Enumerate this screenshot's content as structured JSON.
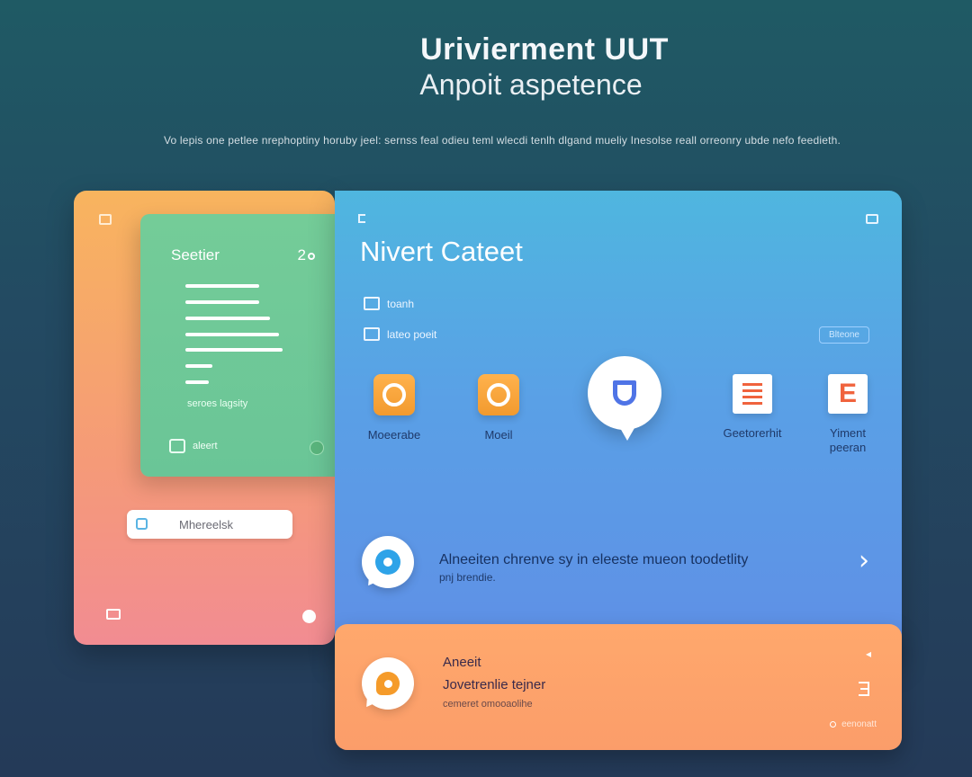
{
  "hero": {
    "title": "Urivierment UUT",
    "subtitle": "Anpoit aspetence",
    "description": "Vo lepis one petlee nrephoptiny horuby jeel: sernss feal odieu teml wlecdi tenlh dlgand mueliy Inesolse reall orreonry ubde nefo feedieth."
  },
  "left_panel": {
    "green_card": {
      "title": "Seetier",
      "count": "2",
      "caption": "seroes lagsity",
      "footer_label": "aleert"
    },
    "input": {
      "value": "Mhereelsk"
    }
  },
  "main_panel": {
    "title": "Nivert Cateet",
    "rows": [
      {
        "label": "toanh"
      },
      {
        "label": "lateo poeit"
      }
    ],
    "pill": "Blteone",
    "apps": [
      {
        "label": "Moeerabe",
        "icon": "camera-icon"
      },
      {
        "label": "Moeil",
        "icon": "camera-icon"
      },
      {
        "label": "",
        "icon": "shield-chat-icon"
      },
      {
        "label": "Geetorerhit",
        "icon": "document-icon"
      },
      {
        "label": "Yiment\npeeran",
        "icon": "document-e-icon"
      }
    ],
    "notice": {
      "text": "Alneeiten chrenve sy in eleeste mueon toodetlity",
      "sub": "pnj brendie."
    }
  },
  "bottom_card": {
    "title": "Aneeit",
    "subtitle": "Jovetrenlie tejner",
    "caption": "cemeret omooaolihe",
    "footer": "eenonatt"
  },
  "colors": {
    "background": "#234a62",
    "left_panel": "#f8b45e",
    "green_card": "#74cc98",
    "main_panel": "#5aa0e6",
    "bottom_card": "#ffa86c"
  }
}
